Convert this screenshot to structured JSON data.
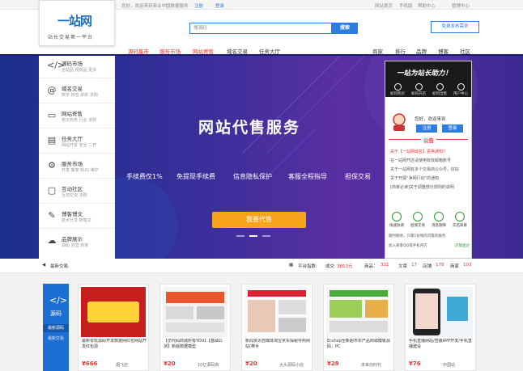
{
  "topbar": {
    "welcome": "您好，欢迎来到商业中国数据服务",
    "register": "注册",
    "login": "登录",
    "links": [
      "网站首页",
      "手机版",
      "帮助中心",
      "管理中心"
    ]
  },
  "logo": {
    "main": "一站网",
    "slogan": "站长交易第一平台"
  },
  "search": {
    "placeholder": "搜源码",
    "button": "搜索"
  },
  "demand_button": "免费发布需求",
  "nav": {
    "main": [
      "源码集市",
      "服务市场",
      "网站寄售",
      "域名交易",
      "任务大厅"
    ],
    "right": [
      "商家",
      "排行",
      "品牌",
      "博客",
      "社区"
    ]
  },
  "sidebar": {
    "items": [
      {
        "title": "源码市场",
        "sub": "全站品  视频品  更多"
      },
      {
        "title": "域名交易",
        "sub": "数字  拼音  单拼  求购"
      },
      {
        "title": "网站寄售",
        "sub": "电子商务  行业  求购"
      },
      {
        "title": "任务大厅",
        "sub": "网站开发  安全  二开"
      },
      {
        "title": "服务市场",
        "sub": "开发  搬家  BUG  维护"
      },
      {
        "title": "互动社区",
        "sub": "互动交流  求购"
      },
      {
        "title": "博客博文",
        "sub": "技术分享  随笔文"
      },
      {
        "title": "品牌展示",
        "sub": "源码  自营  商家"
      }
    ]
  },
  "hero": {
    "title": "网站代售服务",
    "features": [
      "手续费仅1%",
      "免提现手续费",
      "信息隐私保护",
      "客服全程指导",
      "担保交易"
    ],
    "cta": "我要代售"
  },
  "right_panel": {
    "slogan": "一站为站长助力！",
    "quick": [
      "如何购买",
      "如何开店",
      "如何出售",
      "用户中心"
    ],
    "greeting": "您好，欢迎来到",
    "register": "注册",
    "login": "登录",
    "notice_title": "公告",
    "news": [
      "关于【一站网域名】更换通知！",
      "在一站网开店请使用有效邮箱账号",
      "关于一站网有多个交易商公众号。好好",
      "关于开展“净网行动”的通知",
      "[商家必读]关于调整部分规则的说明"
    ],
    "services": [
      "快速协调",
      "担保交易",
      "消息保障",
      "实名商家"
    ],
    "consult": "随时随地，只需1份钱的可靠的服务",
    "qq": "加入商家QQ或手机开店",
    "qq_link": "店铺直达"
  },
  "stats": {
    "latest": "最新交易:",
    "platform_label": "平台指数:",
    "amount_label": "成交",
    "amount": "3863元",
    "goods_label": "商品：",
    "goods": "331",
    "article_label": "文章",
    "articles": "17",
    "shop_label": "店铺",
    "shops": "178",
    "merchant_label": "商家",
    "merchants": "103"
  },
  "category": {
    "name": "源码",
    "links": [
      "最新源码",
      "最新交易"
    ]
  },
  "cards": [
    {
      "title": "最新零玩源码开发数据网红包网站开发红包源",
      "price": "¥666",
      "shop": "烟飞店"
    },
    {
      "title": "【仿代码商城所有YOU】【基础公测】新版数据模型",
      "price": "¥20",
      "shop": "10亿源码商"
    },
    {
      "title": "新闻资讯自媒体淘宝京东探秘导购网站(带手",
      "price": "¥20",
      "shop": "大头源码小店"
    },
    {
      "title": "Ecshop全新超市农产品商城模板源码，PC",
      "price": "¥29",
      "shop": "未来创时代"
    },
    {
      "title": "手机直播网站/直播APP开发/手机直播建设",
      "price": "¥76",
      "shop": "中国站"
    }
  ]
}
